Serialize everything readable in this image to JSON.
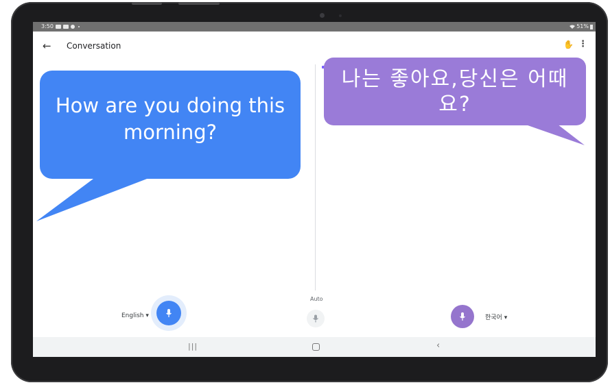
{
  "status_bar": {
    "time": "3:50",
    "battery": "51%"
  },
  "app_bar": {
    "back_icon": "arrow-left-icon",
    "title": "Conversation",
    "hand_icon": "hand-icon",
    "more_icon": "more-vert-icon"
  },
  "controls": {
    "left_language": "English",
    "auto_label": "Auto",
    "right_language": "한국어",
    "colors": {
      "blue": "#4285f4",
      "purple": "#9575cd"
    }
  },
  "callouts": {
    "english": {
      "text": "How are you doing this morning?",
      "color": "#4285f4"
    },
    "korean": {
      "text": "나는 좋아요,당신은 어때요?",
      "color": "#9a7bd8"
    }
  },
  "nav_bar": {
    "recent_icon": "recent-apps-icon",
    "home_icon": "home-icon",
    "back_icon": "back-chevron-icon"
  }
}
